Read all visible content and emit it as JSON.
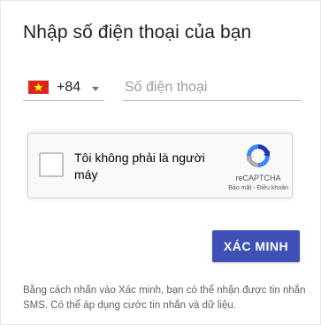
{
  "title": "Nhập số điện thoại của bạn",
  "country": {
    "code": "+84",
    "flag_icon": "vietnam-flag-icon",
    "flag_color": "#da251d",
    "star_color": "#ffff00"
  },
  "phone": {
    "placeholder": "Số điện thoại",
    "value": ""
  },
  "recaptcha": {
    "label": "Tôi không phải là người máy",
    "brand": "reCAPTCHA",
    "privacy": "Bảo mật",
    "separator": " - ",
    "terms": "Điều khoản",
    "logo_icon": "recaptcha-logo-icon"
  },
  "verify_button": {
    "label": "XÁC MINH",
    "color": "#3f51b5"
  },
  "note": "Bằng cách nhấn vào Xác minh, bạn có thể nhận được tin nhắn SMS. Có thể áp dụng cước tin nhắn và dữ liệu."
}
